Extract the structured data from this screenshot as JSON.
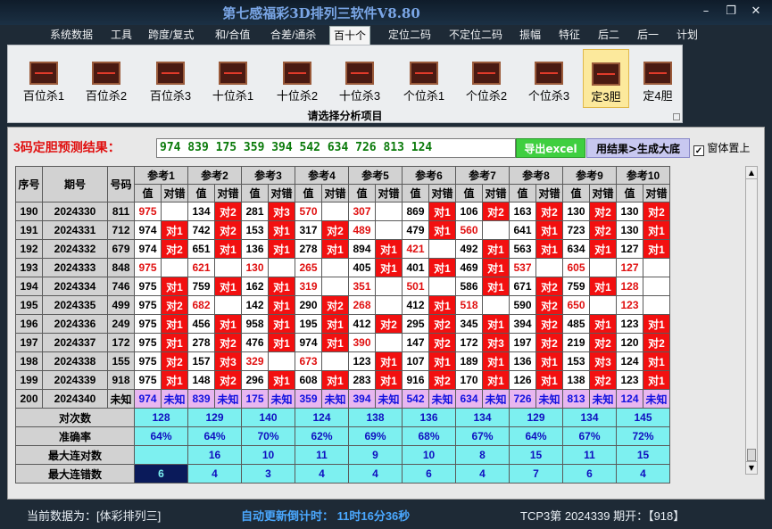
{
  "window": {
    "title": "第七感福彩3D排列三软件V8.80"
  },
  "menu": [
    "系统数据",
    "工具",
    "跨度/复式",
    "和/合值",
    "合差/通杀",
    "百十个",
    "定位二码",
    "不定位二码",
    "振幅",
    "特征",
    "后二",
    "后一",
    "计划"
  ],
  "menu_active": 5,
  "ribbon": {
    "buttons": [
      "百位杀1",
      "百位杀2",
      "百位杀3",
      "十位杀1",
      "十位杀2",
      "十位杀3",
      "个位杀1",
      "个位杀2",
      "个位杀3",
      "定3胆",
      "定4胆"
    ],
    "selected": 9,
    "caption": "请选择分析项目"
  },
  "result": {
    "label": "3码定胆预测结果：",
    "value": "974 839 175 359 394 542 634 726 813 124",
    "excel_button": "导出excel",
    "generate_button": "用结果>生成大底",
    "topmost_label": "窗体置上",
    "topmost_checked": true
  },
  "table": {
    "header_fixed": [
      "序号",
      "期号",
      "号码"
    ],
    "group_labels": [
      "参考1",
      "参考2",
      "参考3",
      "参考4",
      "参考5",
      "参考6",
      "参考7",
      "参考8",
      "参考9",
      "参考10"
    ],
    "sub_value": "值",
    "sub_judge": "对错",
    "rows": [
      {
        "seq": "190",
        "period": "2024330",
        "num": "811",
        "refs": [
          [
            "975",
            ""
          ],
          [
            "134",
            "对2"
          ],
          [
            "281",
            "对3"
          ],
          [
            "570",
            ""
          ],
          [
            "307",
            ""
          ],
          [
            "869",
            "对1"
          ],
          [
            "106",
            "对2"
          ],
          [
            "163",
            "对2"
          ],
          [
            "130",
            "对2"
          ],
          [
            "130",
            "对2"
          ]
        ]
      },
      {
        "seq": "191",
        "period": "2024331",
        "num": "712",
        "refs": [
          [
            "974",
            "对1"
          ],
          [
            "742",
            "对2"
          ],
          [
            "153",
            "对1"
          ],
          [
            "317",
            "对2"
          ],
          [
            "489",
            ""
          ],
          [
            "479",
            "对1"
          ],
          [
            "560",
            ""
          ],
          [
            "641",
            "对1"
          ],
          [
            "723",
            "对2"
          ],
          [
            "130",
            "对1"
          ]
        ]
      },
      {
        "seq": "192",
        "period": "2024332",
        "num": "679",
        "refs": [
          [
            "974",
            "对2"
          ],
          [
            "651",
            "对1"
          ],
          [
            "136",
            "对1"
          ],
          [
            "278",
            "对1"
          ],
          [
            "894",
            "对1"
          ],
          [
            "421",
            ""
          ],
          [
            "492",
            "对1"
          ],
          [
            "563",
            "对1"
          ],
          [
            "634",
            "对1"
          ],
          [
            "127",
            "对1"
          ]
        ]
      },
      {
        "seq": "193",
        "period": "2024333",
        "num": "848",
        "refs": [
          [
            "975",
            ""
          ],
          [
            "621",
            ""
          ],
          [
            "130",
            ""
          ],
          [
            "265",
            ""
          ],
          [
            "405",
            "对1"
          ],
          [
            "401",
            "对1"
          ],
          [
            "469",
            "对1"
          ],
          [
            "537",
            ""
          ],
          [
            "605",
            ""
          ],
          [
            "127",
            ""
          ]
        ]
      },
      {
        "seq": "194",
        "period": "2024334",
        "num": "746",
        "refs": [
          [
            "975",
            "对1"
          ],
          [
            "759",
            "对1"
          ],
          [
            "162",
            "对1"
          ],
          [
            "319",
            ""
          ],
          [
            "351",
            ""
          ],
          [
            "501",
            ""
          ],
          [
            "586",
            "对1"
          ],
          [
            "671",
            "对2"
          ],
          [
            "759",
            "对1"
          ],
          [
            "128",
            ""
          ]
        ]
      },
      {
        "seq": "195",
        "period": "2024335",
        "num": "499",
        "refs": [
          [
            "975",
            "对2"
          ],
          [
            "682",
            ""
          ],
          [
            "142",
            "对1"
          ],
          [
            "290",
            "对2"
          ],
          [
            "268",
            ""
          ],
          [
            "412",
            "对1"
          ],
          [
            "518",
            ""
          ],
          [
            "590",
            "对2"
          ],
          [
            "650",
            ""
          ],
          [
            "123",
            ""
          ]
        ]
      },
      {
        "seq": "196",
        "period": "2024336",
        "num": "249",
        "refs": [
          [
            "975",
            "对1"
          ],
          [
            "456",
            "对1"
          ],
          [
            "958",
            "对1"
          ],
          [
            "195",
            "对1"
          ],
          [
            "412",
            "对2"
          ],
          [
            "295",
            "对2"
          ],
          [
            "345",
            "对1"
          ],
          [
            "394",
            "对2"
          ],
          [
            "485",
            "对1"
          ],
          [
            "123",
            "对1"
          ]
        ]
      },
      {
        "seq": "197",
        "period": "2024337",
        "num": "172",
        "refs": [
          [
            "975",
            "对1"
          ],
          [
            "278",
            "对2"
          ],
          [
            "476",
            "对1"
          ],
          [
            "974",
            "对1"
          ],
          [
            "390",
            ""
          ],
          [
            "147",
            "对2"
          ],
          [
            "172",
            "对3"
          ],
          [
            "197",
            "对2"
          ],
          [
            "219",
            "对2"
          ],
          [
            "120",
            "对2"
          ]
        ]
      },
      {
        "seq": "198",
        "period": "2024338",
        "num": "155",
        "refs": [
          [
            "975",
            "对2"
          ],
          [
            "157",
            "对3"
          ],
          [
            "329",
            ""
          ],
          [
            "673",
            ""
          ],
          [
            "123",
            "对1"
          ],
          [
            "107",
            "对1"
          ],
          [
            "189",
            "对1"
          ],
          [
            "136",
            "对1"
          ],
          [
            "153",
            "对3"
          ],
          [
            "124",
            "对1"
          ]
        ]
      },
      {
        "seq": "199",
        "period": "2024339",
        "num": "918",
        "refs": [
          [
            "975",
            "对1"
          ],
          [
            "148",
            "对2"
          ],
          [
            "296",
            "对1"
          ],
          [
            "608",
            "对1"
          ],
          [
            "283",
            "对1"
          ],
          [
            "916",
            "对2"
          ],
          [
            "170",
            "对1"
          ],
          [
            "126",
            "对1"
          ],
          [
            "138",
            "对2"
          ],
          [
            "123",
            "对1"
          ]
        ]
      }
    ],
    "pending": {
      "seq": "200",
      "period": "2024340",
      "num": "未知",
      "values": [
        "974",
        "839",
        "175",
        "359",
        "394",
        "542",
        "634",
        "726",
        "813",
        "124"
      ],
      "judge": "未知"
    },
    "summary": [
      {
        "label": "对次数",
        "values": [
          "128",
          "129",
          "140",
          "124",
          "138",
          "136",
          "134",
          "129",
          "134",
          "145"
        ]
      },
      {
        "label": "准确率",
        "values": [
          "64%",
          "64%",
          "70%",
          "62%",
          "69%",
          "68%",
          "67%",
          "64%",
          "67%",
          "72%"
        ]
      },
      {
        "label": "最大连对数",
        "values": [
          "16",
          "10",
          "11",
          "9",
          "10",
          "8",
          "15",
          "11",
          "15"
        ]
      },
      {
        "label": "最大连错数",
        "values": [
          "6",
          "4",
          "3",
          "4",
          "4",
          "6",
          "4",
          "7",
          "6",
          "4"
        ]
      }
    ]
  },
  "status": {
    "source": "当前数据为：[体彩排列三]",
    "countdown": "自动更新倒计时： 11时16分36秒",
    "latest": "TCP3第 2024339 期开：【918】"
  },
  "colors": {
    "hit": "#f21010",
    "miss_text": "#e01010",
    "pending_row": "#e8b6f0",
    "summary": "#7df0f0",
    "result_text": "#0a7a0a"
  }
}
